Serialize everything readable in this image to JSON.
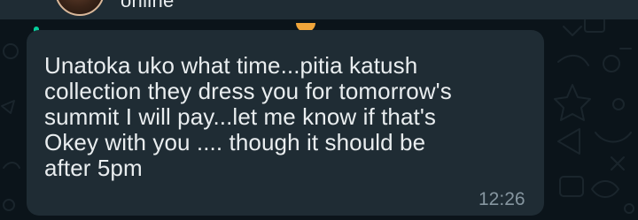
{
  "header": {
    "status_text": "online"
  },
  "message": {
    "lines": [
      "Unatoka uko what time...pitia katush",
      "collection they dress you for tomorrow's",
      "summit I will pay...let me know if that's",
      "Okey with you .... though it should be",
      "after 5pm"
    ],
    "time": "12:26"
  },
  "colors": {
    "background": "#0b141a",
    "bubble": "#1f2c34",
    "text": "#e9edef",
    "meta_text": "#8696a0",
    "accent": "#06cf9c"
  }
}
